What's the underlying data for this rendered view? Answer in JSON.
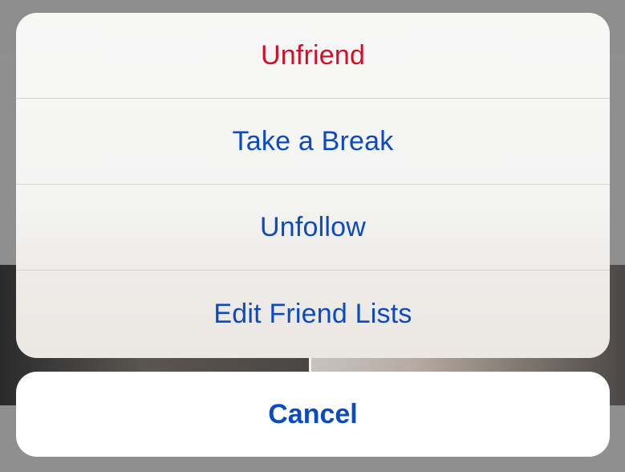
{
  "action_sheet": {
    "actions": [
      {
        "label": "Unfriend",
        "style": "destructive",
        "color": "#d0102a"
      },
      {
        "label": "Take a Break",
        "style": "default",
        "color": "#0b4ac0"
      },
      {
        "label": "Unfollow",
        "style": "default",
        "color": "#0b4ac0"
      },
      {
        "label": "Edit Friend Lists",
        "style": "default",
        "color": "#0b4ac0"
      }
    ],
    "cancel_label": "Cancel"
  }
}
